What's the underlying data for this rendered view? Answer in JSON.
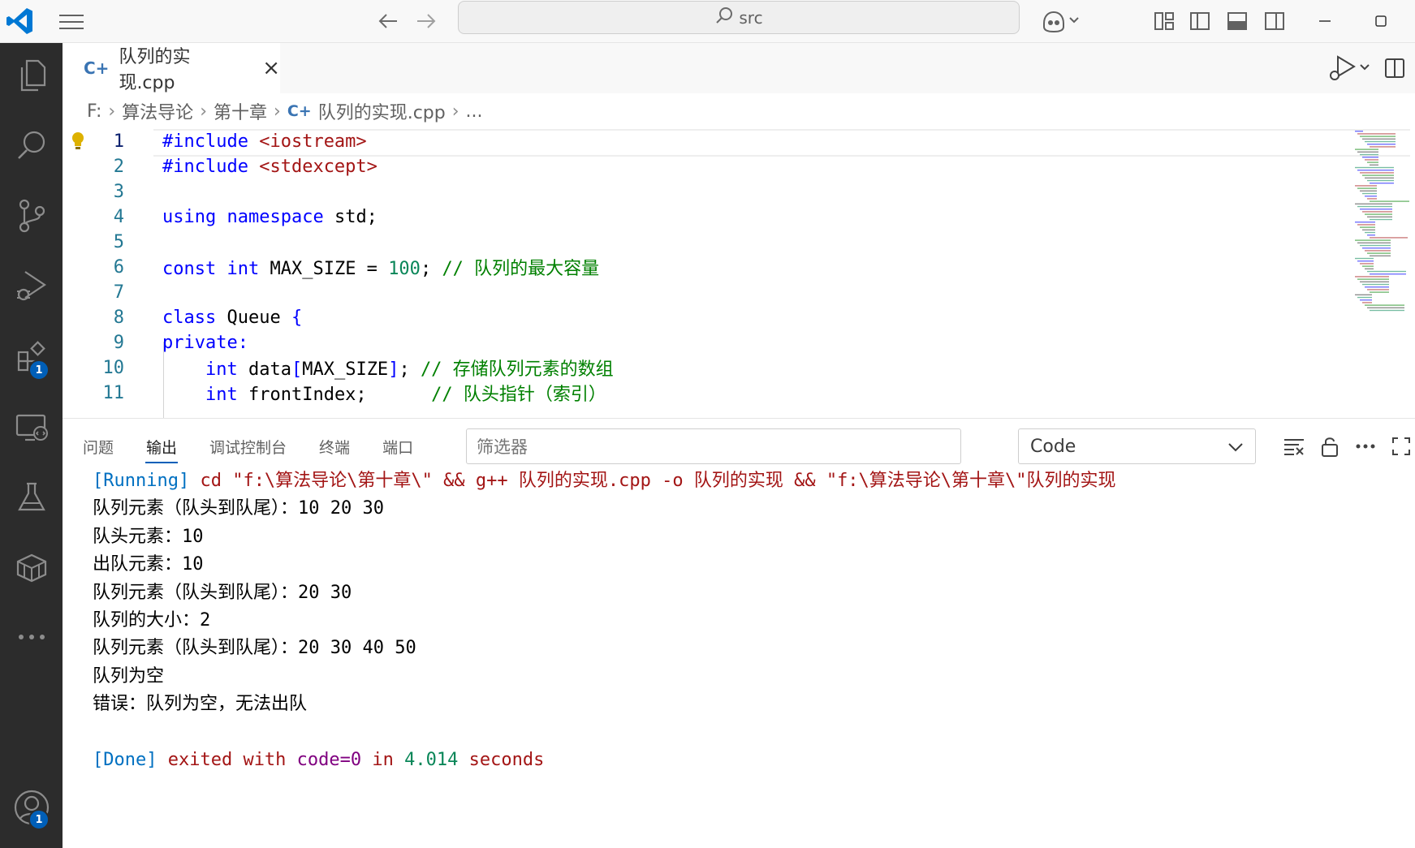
{
  "titlebar": {
    "search_text": "src"
  },
  "activitybar": {
    "extensions_badge": "1",
    "accounts_badge": "1"
  },
  "tab": {
    "icon_glyph": "C+",
    "filename": "队列的实现.cpp",
    "close_glyph": "×"
  },
  "breadcrumb": {
    "items": [
      "F:",
      "算法导论",
      "第十章",
      "队列的实现.cpp",
      "..."
    ]
  },
  "editor": {
    "lines": [
      {
        "num": "1",
        "tokens": [
          {
            "t": "#include",
            "c": "pp"
          },
          {
            "t": " ",
            "c": "plain"
          },
          {
            "t": "<iostream>",
            "c": "inc"
          }
        ]
      },
      {
        "num": "2",
        "tokens": [
          {
            "t": "#include",
            "c": "pp"
          },
          {
            "t": " ",
            "c": "plain"
          },
          {
            "t": "<stdexcept>",
            "c": "inc"
          }
        ]
      },
      {
        "num": "3",
        "tokens": []
      },
      {
        "num": "4",
        "tokens": [
          {
            "t": "using",
            "c": "kw"
          },
          {
            "t": " ",
            "c": "plain"
          },
          {
            "t": "namespace",
            "c": "kw"
          },
          {
            "t": " std;",
            "c": "plain"
          }
        ]
      },
      {
        "num": "5",
        "tokens": []
      },
      {
        "num": "6",
        "tokens": [
          {
            "t": "const",
            "c": "kw"
          },
          {
            "t": " ",
            "c": "plain"
          },
          {
            "t": "int",
            "c": "ty"
          },
          {
            "t": " MAX_SIZE = ",
            "c": "plain"
          },
          {
            "t": "100",
            "c": "num"
          },
          {
            "t": "; ",
            "c": "plain"
          },
          {
            "t": "// 队列的最大容量",
            "c": "cm"
          }
        ]
      },
      {
        "num": "7",
        "tokens": []
      },
      {
        "num": "8",
        "tokens": [
          {
            "t": "class",
            "c": "kw"
          },
          {
            "t": " Queue ",
            "c": "plain"
          },
          {
            "t": "{",
            "c": "kw"
          }
        ]
      },
      {
        "num": "9",
        "tokens": [
          {
            "t": "private:",
            "c": "kw"
          }
        ]
      },
      {
        "num": "10",
        "tokens": [
          {
            "t": "    ",
            "c": "plain"
          },
          {
            "t": "int",
            "c": "ty"
          },
          {
            "t": " data",
            "c": "plain"
          },
          {
            "t": "[",
            "c": "kw"
          },
          {
            "t": "MAX_SIZE",
            "c": "plain"
          },
          {
            "t": "]",
            "c": "kw"
          },
          {
            "t": "; ",
            "c": "plain"
          },
          {
            "t": "// 存储队列元素的数组",
            "c": "cm"
          }
        ]
      },
      {
        "num": "11",
        "tokens": [
          {
            "t": "    ",
            "c": "plain"
          },
          {
            "t": "int",
            "c": "ty"
          },
          {
            "t": " frontIndex;      ",
            "c": "plain"
          },
          {
            "t": "// 队头指针（索引）",
            "c": "cm"
          }
        ]
      }
    ]
  },
  "panel": {
    "tabs": [
      "问题",
      "输出",
      "调试控制台",
      "终端",
      "端口"
    ],
    "active_tab": "输出",
    "filter_placeholder": "筛选器",
    "channel_select": "Code",
    "output_lines": [
      [
        {
          "t": "[Running]",
          "c": "o-blue"
        },
        {
          "t": " cd \"f:\\算法导论\\第十章\\\" && g++ 队列的实现.cpp -o 队列的实现 && \"f:\\算法导论\\第十章\\\"队列的实现",
          "c": "o-red"
        }
      ],
      [
        {
          "t": "队列元素（队头到队尾）：10 20 30",
          "c": "o-plain"
        }
      ],
      [
        {
          "t": "队头元素：10",
          "c": "o-plain"
        }
      ],
      [
        {
          "t": "出队元素：10",
          "c": "o-plain"
        }
      ],
      [
        {
          "t": "队列元素（队头到队尾）：20 30",
          "c": "o-plain"
        }
      ],
      [
        {
          "t": "队列的大小：2",
          "c": "o-plain"
        }
      ],
      [
        {
          "t": "队列元素（队头到队尾）：20 30 40 50",
          "c": "o-plain"
        }
      ],
      [
        {
          "t": "队列为空",
          "c": "o-plain"
        }
      ],
      [
        {
          "t": "错误：队列为空，无法出队",
          "c": "o-plain"
        }
      ],
      [],
      [
        {
          "t": "[Done]",
          "c": "o-blue"
        },
        {
          "t": " exited with ",
          "c": "o-red"
        },
        {
          "t": "code=0",
          "c": "o-purple"
        },
        {
          "t": " in ",
          "c": "o-red"
        },
        {
          "t": "4.014",
          "c": "o-green"
        },
        {
          "t": " seconds",
          "c": "o-red"
        }
      ]
    ]
  },
  "colors": {
    "accent": "#005fb8",
    "activitybar_bg": "#2c2c2c",
    "keyword": "#0000ff",
    "string": "#a31515",
    "comment": "#008000",
    "number": "#098658"
  }
}
